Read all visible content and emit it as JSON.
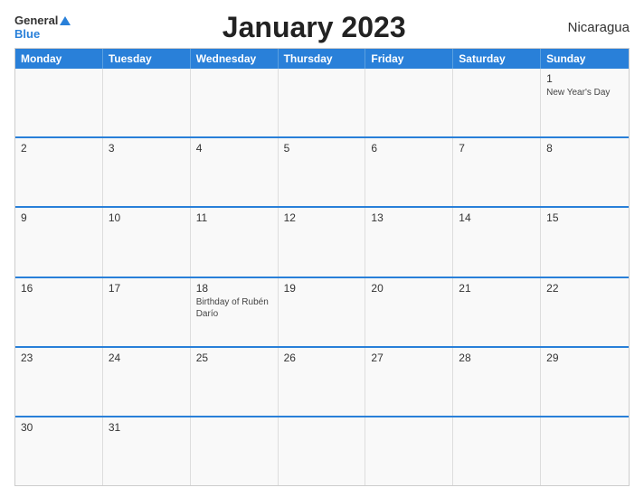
{
  "header": {
    "title": "January 2023",
    "country": "Nicaragua"
  },
  "logo": {
    "general": "General",
    "blue": "Blue"
  },
  "days": [
    "Monday",
    "Tuesday",
    "Wednesday",
    "Thursday",
    "Friday",
    "Saturday",
    "Sunday"
  ],
  "weeks": [
    [
      {
        "num": "",
        "event": ""
      },
      {
        "num": "",
        "event": ""
      },
      {
        "num": "",
        "event": ""
      },
      {
        "num": "",
        "event": ""
      },
      {
        "num": "",
        "event": ""
      },
      {
        "num": "",
        "event": ""
      },
      {
        "num": "1",
        "event": "New Year's Day"
      }
    ],
    [
      {
        "num": "2",
        "event": ""
      },
      {
        "num": "3",
        "event": ""
      },
      {
        "num": "4",
        "event": ""
      },
      {
        "num": "5",
        "event": ""
      },
      {
        "num": "6",
        "event": ""
      },
      {
        "num": "7",
        "event": ""
      },
      {
        "num": "8",
        "event": ""
      }
    ],
    [
      {
        "num": "9",
        "event": ""
      },
      {
        "num": "10",
        "event": ""
      },
      {
        "num": "11",
        "event": ""
      },
      {
        "num": "12",
        "event": ""
      },
      {
        "num": "13",
        "event": ""
      },
      {
        "num": "14",
        "event": ""
      },
      {
        "num": "15",
        "event": ""
      }
    ],
    [
      {
        "num": "16",
        "event": ""
      },
      {
        "num": "17",
        "event": ""
      },
      {
        "num": "18",
        "event": "Birthday of Rubén Darío"
      },
      {
        "num": "19",
        "event": ""
      },
      {
        "num": "20",
        "event": ""
      },
      {
        "num": "21",
        "event": ""
      },
      {
        "num": "22",
        "event": ""
      }
    ],
    [
      {
        "num": "23",
        "event": ""
      },
      {
        "num": "24",
        "event": ""
      },
      {
        "num": "25",
        "event": ""
      },
      {
        "num": "26",
        "event": ""
      },
      {
        "num": "27",
        "event": ""
      },
      {
        "num": "28",
        "event": ""
      },
      {
        "num": "29",
        "event": ""
      }
    ],
    [
      {
        "num": "30",
        "event": ""
      },
      {
        "num": "31",
        "event": ""
      },
      {
        "num": "",
        "event": ""
      },
      {
        "num": "",
        "event": ""
      },
      {
        "num": "",
        "event": ""
      },
      {
        "num": "",
        "event": ""
      },
      {
        "num": "",
        "event": ""
      }
    ]
  ]
}
